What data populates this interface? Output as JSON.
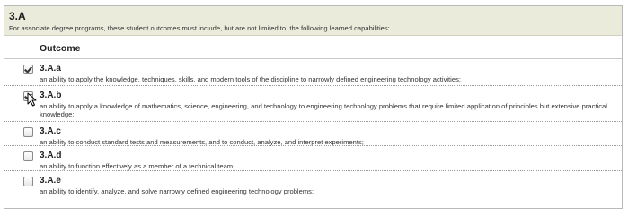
{
  "section": {
    "title": "3.A",
    "description": "For associate degree programs, these student outcomes must include, but are not limited to, the following learned capabilities:"
  },
  "table": {
    "column_header": "Outcome",
    "rows": [
      {
        "code": "3.A.a",
        "checked": true,
        "text": "an ability to apply the knowledge, techniques, skills, and modern tools of the discipline to narrowly defined engineering technology activities;"
      },
      {
        "code": "3.A.b",
        "checked": true,
        "text": "an ability to apply a knowledge of mathematics, science, engineering, and technology to engineering technology problems that require limited application of principles but extensive practical knowledge;"
      },
      {
        "code": "3.A.c",
        "checked": false,
        "text": "an ability to conduct standard tests and measurements, and to conduct, analyze, and interpret experiments;"
      },
      {
        "code": "3.A.d",
        "checked": false,
        "text": "an ability to function effectively as a member of a technical team;"
      },
      {
        "code": "3.A.e",
        "checked": false,
        "text": "an ability to identify, analyze, and solve narrowly defined engineering technology problems;"
      }
    ]
  }
}
